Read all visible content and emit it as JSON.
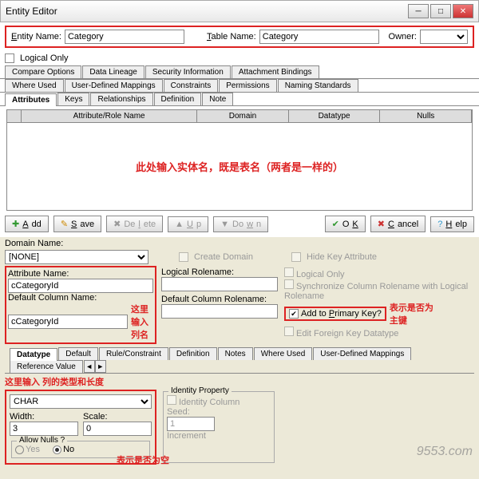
{
  "window": {
    "title": "Entity Editor"
  },
  "header": {
    "entity_name_label": "Entity Name:",
    "entity_name_value": "Category",
    "table_name_label": "Table Name:",
    "table_name_value": "Category",
    "owner_label": "Owner:",
    "logical_only_label": "Logical Only"
  },
  "tabsTop": {
    "row1": [
      "Compare Options",
      "Data Lineage",
      "Security Information",
      "Attachment Bindings"
    ],
    "row2": [
      "Where Used",
      "User-Defined Mappings",
      "Constraints",
      "Permissions",
      "Naming Standards"
    ],
    "row3": [
      "Attributes",
      "Keys",
      "Relationships",
      "Definition",
      "Note"
    ]
  },
  "grid": {
    "cols": [
      "Attribute/Role Name",
      "Domain",
      "Datatype",
      "Nulls"
    ]
  },
  "annotation1": "此处输入实体名，既是表名（两者是一样的）",
  "buttons": {
    "add": "Add",
    "save": "Save",
    "delete": "Delete",
    "up": "Up",
    "down": "Down",
    "ok": "OK",
    "cancel": "Cancel",
    "help": "Help"
  },
  "domain": {
    "label": "Domain Name:",
    "value": "[NONE]",
    "create": "Create Domain"
  },
  "attr": {
    "attr_name_label": "Attribute Name:",
    "attr_name_value": "cCategoryId",
    "def_col_label": "Default Column Name:",
    "def_col_value": "cCategoryId",
    "ann_col": "这里输入列名",
    "log_role_label": "Logical Rolename:",
    "def_col_role_label": "Default Column Rolename:",
    "hide_key": "Hide Key Attribute",
    "logical_only": "Logical Only",
    "sync": "Synchronize Column Rolename with Logical Rolename",
    "add_pk": "Add to Primary Key?",
    "edit_fk": "Edit Foreign Key Datatype",
    "ann_pk1": "表示是否为",
    "ann_pk2": "主键"
  },
  "tabs2": [
    "Datatype",
    "Default",
    "Rule/Constraint",
    "Definition",
    "Notes",
    "Where Used",
    "User-Defined Mappings",
    "Reference Value"
  ],
  "datatype": {
    "ann": "这里输入 列的类型和长度",
    "type": "CHAR",
    "width_label": "Width:",
    "width": "3",
    "scale_label": "Scale:",
    "scale": "0",
    "allow_nulls": "Allow Nulls ?",
    "yes": "Yes",
    "no": "No",
    "ann_null": "表示是否为空",
    "identity": "Identity Property",
    "identity_col": "Identity Column",
    "seed_label": "Seed:",
    "seed": "1",
    "incr_label": "Increment"
  },
  "watermark": "9553.com"
}
